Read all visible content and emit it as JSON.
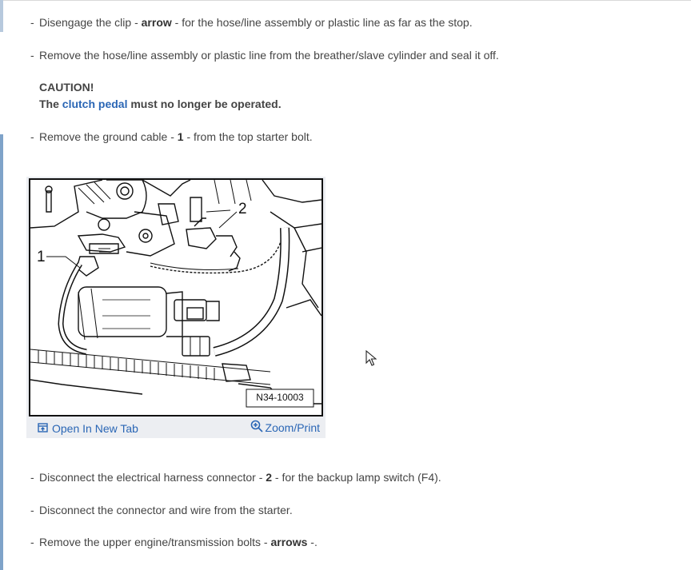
{
  "steps_top": [
    {
      "pre": "Disengage the clip - ",
      "bold": "arrow",
      "post": " - for the hose/line assembly or plastic line as far as the stop."
    },
    {
      "pre": "Remove the hose/line assembly or plastic line from the breather/slave cylinder and seal it off.",
      "bold": "",
      "post": ""
    }
  ],
  "caution": {
    "title": "CAUTION!",
    "pre": "The ",
    "link": "clutch pedal",
    "post": " must no longer be operated."
  },
  "step_ground": {
    "pre": "Remove the ground cable - ",
    "bold": "1",
    "post": " - from the top starter bolt."
  },
  "figure": {
    "label_1": "1",
    "label_2": "2",
    "ref": "N34-10003",
    "open_tab": "Open In New Tab",
    "zoom": "Zoom/Print"
  },
  "steps_bottom": [
    {
      "pre": "Disconnect the electrical harness connector - ",
      "bold": "2",
      "post": " - for the backup lamp switch (F4)."
    },
    {
      "pre": "Disconnect the connector and wire from the starter.",
      "bold": "",
      "post": ""
    },
    {
      "pre": "Remove the upper engine/transmission bolts - ",
      "bold": "arrows",
      "post": " -."
    }
  ],
  "dash": "-",
  "colors": {
    "link": "#2a66b5",
    "text": "#444444",
    "figure_bg": "#eceef2"
  }
}
